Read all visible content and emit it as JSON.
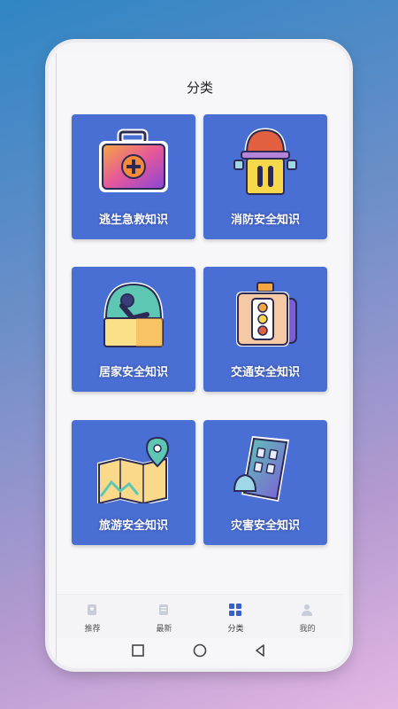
{
  "header": {
    "title": "分类"
  },
  "categories": [
    {
      "label": "逃生急救知识",
      "icon": "first-aid-kit-icon"
    },
    {
      "label": "消防安全知识",
      "icon": "fire-hydrant-icon"
    },
    {
      "label": "居家安全知识",
      "icon": "home-faucet-icon"
    },
    {
      "label": "交通安全知识",
      "icon": "traffic-light-icon"
    },
    {
      "label": "旅游安全知识",
      "icon": "travel-map-icon"
    },
    {
      "label": "灾害安全知识",
      "icon": "disaster-building-icon"
    }
  ],
  "tabbar": {
    "items": [
      {
        "label": "推荐",
        "icon": "recommend-icon"
      },
      {
        "label": "最新",
        "icon": "latest-icon"
      },
      {
        "label": "分类",
        "icon": "category-grid-icon",
        "active": true
      },
      {
        "label": "我的",
        "icon": "profile-icon"
      }
    ]
  },
  "colors": {
    "card": "#4a6fd4",
    "accent": "#3a5fcd"
  }
}
